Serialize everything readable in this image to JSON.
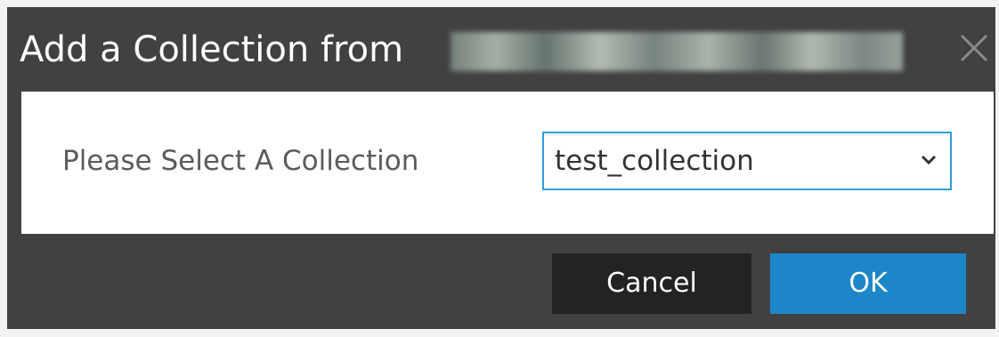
{
  "dialog": {
    "title": "Add a Collection from",
    "close_icon": "close-icon",
    "field_label": "Please Select A Collection",
    "collection_select": {
      "selected": "test_collection",
      "chevron_icon": "chevron-down-icon"
    },
    "buttons": {
      "cancel": "Cancel",
      "ok": "OK"
    }
  },
  "colors": {
    "dialog_bg": "#414141",
    "content_bg": "#ffffff",
    "select_border": "#2f9fd8",
    "cancel_bg": "#232323",
    "ok_bg": "#1d86c8"
  }
}
